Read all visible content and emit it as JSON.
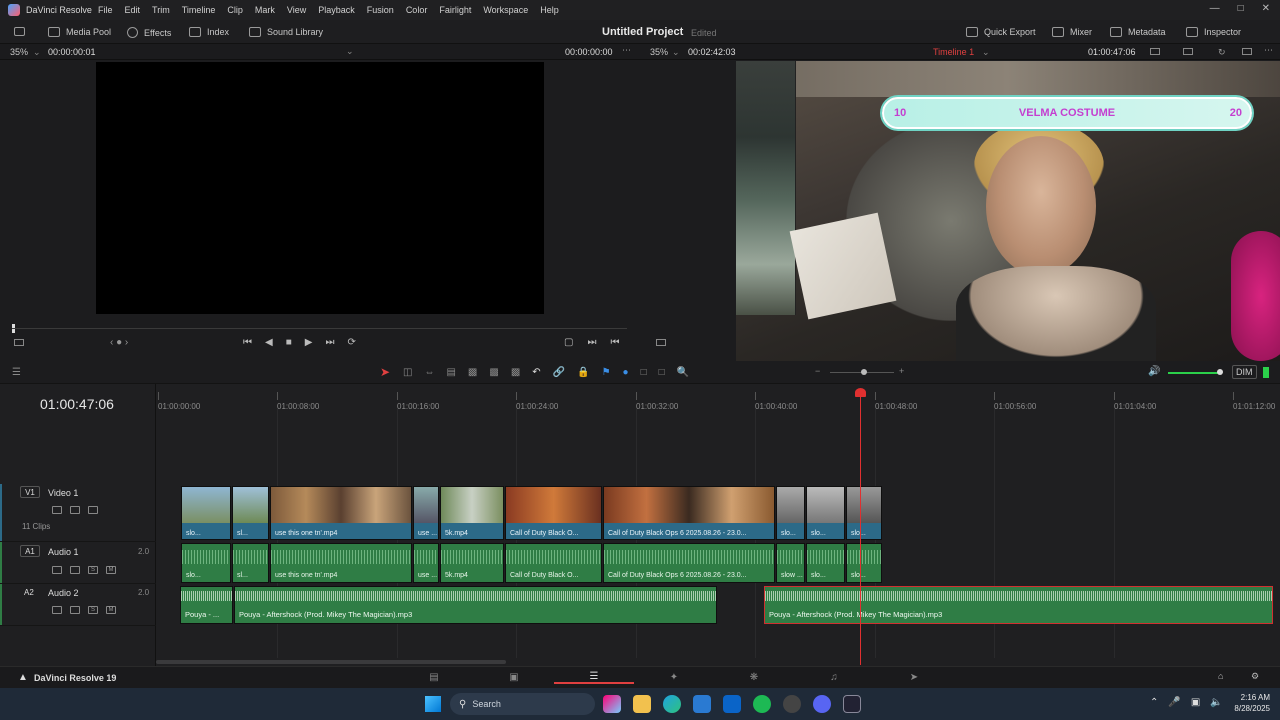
{
  "menubar": {
    "app_name": "DaVinci Resolve",
    "menus": [
      "File",
      "Edit",
      "Trim",
      "Timeline",
      "Clip",
      "Mark",
      "View",
      "Playback",
      "Fusion",
      "Color",
      "Fairlight",
      "Workspace",
      "Help"
    ]
  },
  "toolbar": {
    "media_pool": "Media Pool",
    "effects": "Effects",
    "index": "Index",
    "sound_library": "Sound Library",
    "project_title": "Untitled Project",
    "project_status": "Edited",
    "quick_export": "Quick Export",
    "mixer": "Mixer",
    "metadata": "Metadata",
    "inspector": "Inspector"
  },
  "source_viewer": {
    "zoom": "35%",
    "timecode_left": "00:00:00:01",
    "timecode_right": "00:00:00:00"
  },
  "timeline_viewer": {
    "zoom": "35%",
    "duration": "00:02:42:03",
    "timeline_name": "Timeline 1",
    "timecode": "01:00:47:06"
  },
  "overlay": {
    "left_count": "10",
    "title": "VELMA COSTUME",
    "right_count": "20"
  },
  "edit_tools": {
    "dim_label": "DIM"
  },
  "timeline": {
    "timecode": "01:00:47:06",
    "ruler": [
      "01:00:00:00",
      "01:00:08:00",
      "01:00:16:00",
      "01:00:24:00",
      "01:00:32:00",
      "01:00:40:00",
      "01:00:48:00",
      "01:00:56:00",
      "01:01:04:00",
      "01:01:12:00"
    ],
    "tracks": {
      "v1": {
        "badge": "V1",
        "name": "Video 1",
        "clips_count": "11 Clips"
      },
      "a1": {
        "badge": "A1",
        "name": "Audio 1",
        "vol": "2.0"
      },
      "a2": {
        "badge": "A2",
        "name": "Audio 2",
        "vol": "2.0"
      }
    },
    "video_clips": [
      "slo...",
      "sl...",
      "use this one tn'.mp4",
      "use ...",
      "5k.mp4",
      "Call of Duty  Black O...",
      "Call of Duty  Black Ops 6 2025.08.26 - 23.0...",
      "slo...",
      "slo...",
      "slo..."
    ],
    "audio1_clips": [
      "slo...",
      "sl...",
      "use this one tn'.mp4",
      "use ...",
      "5k.mp4",
      "Call of Duty  Black O...",
      "Call of Duty  Black Ops 6 2025.08.26 - 23.0...",
      "slow ...",
      "slo...",
      "slo..."
    ],
    "audio2_clips": [
      "Pouya - ...",
      "Pouya - Aftershock (Prod. Mikey The Magician).mp3",
      "Pouya - Aftershock (Prod. Mikey The Magician).mp3"
    ]
  },
  "pagebar": {
    "brand": "DaVinci Resolve 19"
  },
  "taskbar": {
    "search_placeholder": "Search",
    "time": "2:16 AM",
    "date": "8/28/2025"
  }
}
